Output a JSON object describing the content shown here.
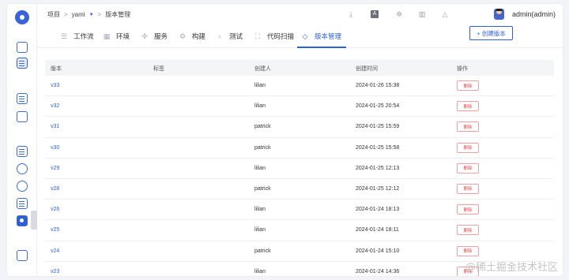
{
  "breadcrumb": {
    "root": "项目",
    "project": "yami",
    "current": "版本管理"
  },
  "user": {
    "name": "admin(admin)"
  },
  "tabs": [
    {
      "label": "工作流",
      "icon": "workflow-icon"
    },
    {
      "label": "环境",
      "icon": "environment-icon"
    },
    {
      "label": "服务",
      "icon": "service-icon"
    },
    {
      "label": "构建",
      "icon": "build-icon"
    },
    {
      "label": "测试",
      "icon": "test-icon"
    },
    {
      "label": "代码扫描",
      "icon": "scan-icon"
    },
    {
      "label": "版本管理",
      "icon": "version-icon",
      "active": true
    }
  ],
  "actions": {
    "create_version": "+ 创建版本"
  },
  "table": {
    "headers": [
      "版本",
      "标签",
      "创建人",
      "创建时间",
      "操作"
    ],
    "rows": [
      {
        "version": "v33",
        "tag": "",
        "creator": "lilian",
        "time": "2024-01-26 15:38",
        "action": "删除"
      },
      {
        "version": "v32",
        "tag": "",
        "creator": "lilian",
        "time": "2024-01-25 20:54",
        "action": "删除"
      },
      {
        "version": "v31",
        "tag": "",
        "creator": "patrick",
        "time": "2024-01-25 15:59",
        "action": "删除"
      },
      {
        "version": "v30",
        "tag": "",
        "creator": "patrick",
        "time": "2024-01-25 15:58",
        "action": "删除"
      },
      {
        "version": "v29",
        "tag": "",
        "creator": "lilian",
        "time": "2024-01-25 12:13",
        "action": "删除"
      },
      {
        "version": "v28",
        "tag": "",
        "creator": "patrick",
        "time": "2024-01-25 12:12",
        "action": "删除"
      },
      {
        "version": "v26",
        "tag": "",
        "creator": "lilian",
        "time": "2024-01-24 18:13",
        "action": "删除"
      },
      {
        "version": "v25",
        "tag": "",
        "creator": "lilian",
        "time": "2024-01-24 18:11",
        "action": "删除"
      },
      {
        "version": "v24",
        "tag": "",
        "creator": "patrick",
        "time": "2024-01-24 15:10",
        "action": "删除"
      },
      {
        "version": "v23",
        "tag": "",
        "creator": "lilian",
        "time": "2024-01-24 14:36",
        "action": "删除"
      }
    ]
  },
  "watermark": "@稀土掘金技术社区",
  "colors": {
    "accent": "#2f5fd6",
    "danger": "#e14a4a"
  }
}
